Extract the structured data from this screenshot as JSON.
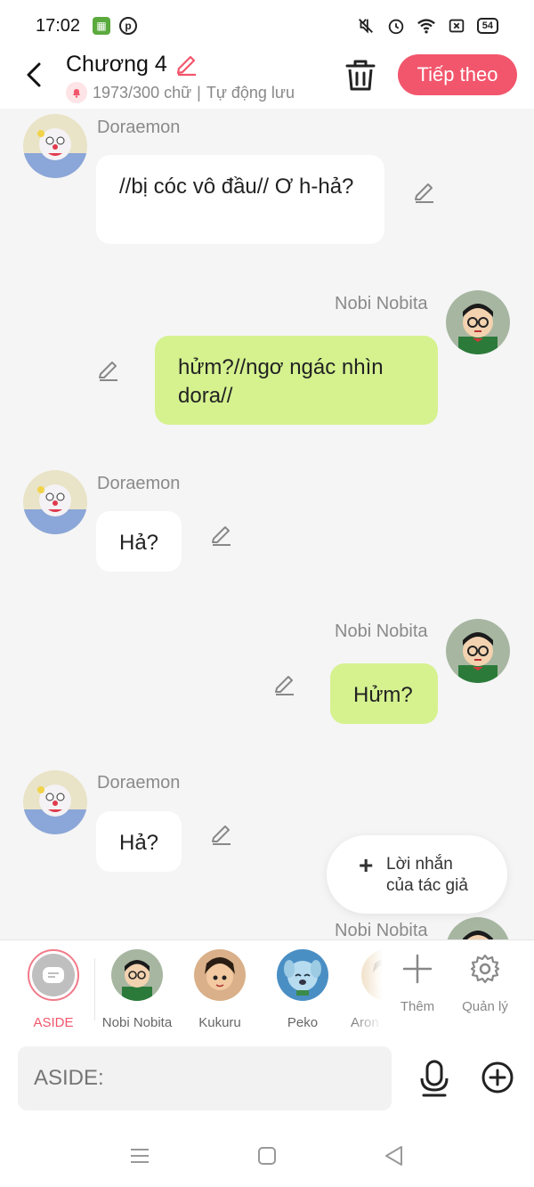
{
  "status": {
    "time": "17:02",
    "battery": "54"
  },
  "header": {
    "title": "Chương 4",
    "word_count": "1973/300 chữ",
    "separator": "|",
    "autosave": "Tự động lưu",
    "next_label": "Tiếp theo"
  },
  "messages": [
    {
      "name": "Doraemon",
      "text": "//bị cóc vô đầu// Ơ h-hả?"
    },
    {
      "name": "Nobi Nobita",
      "text": "hửm?//ngơ ngác nhìn dora//"
    },
    {
      "name": "Doraemon",
      "text": "Hả?"
    },
    {
      "name": "Nobi Nobita",
      "text": "Hửm?"
    },
    {
      "name": "Doraemon",
      "text": "Hả?"
    },
    {
      "name": "Nobi Nobita",
      "text": ""
    }
  ],
  "author_note": {
    "line1": "Lời nhắn",
    "line2": "của tác giả"
  },
  "characters": [
    {
      "label": "ASIDE"
    },
    {
      "label": "Nobi Nobita"
    },
    {
      "label": "Kukuru"
    },
    {
      "label": "Peko"
    },
    {
      "label": "Aron"
    }
  ],
  "tools": {
    "more_label": "Thêm",
    "manage_label": "Quản lý"
  },
  "input": {
    "placeholder": "ASIDE:"
  },
  "colors": {
    "accent": "#f2566c",
    "right_bubble": "#d5f28f",
    "background": "#f5f5f5"
  },
  "icons": [
    "back-arrow-icon",
    "pencil-icon",
    "bell-icon",
    "trash-icon",
    "plus-icon",
    "gear-icon",
    "microphone-icon",
    "add-circle-icon",
    "menu-icon",
    "home-square-icon",
    "back-triangle-icon"
  ]
}
